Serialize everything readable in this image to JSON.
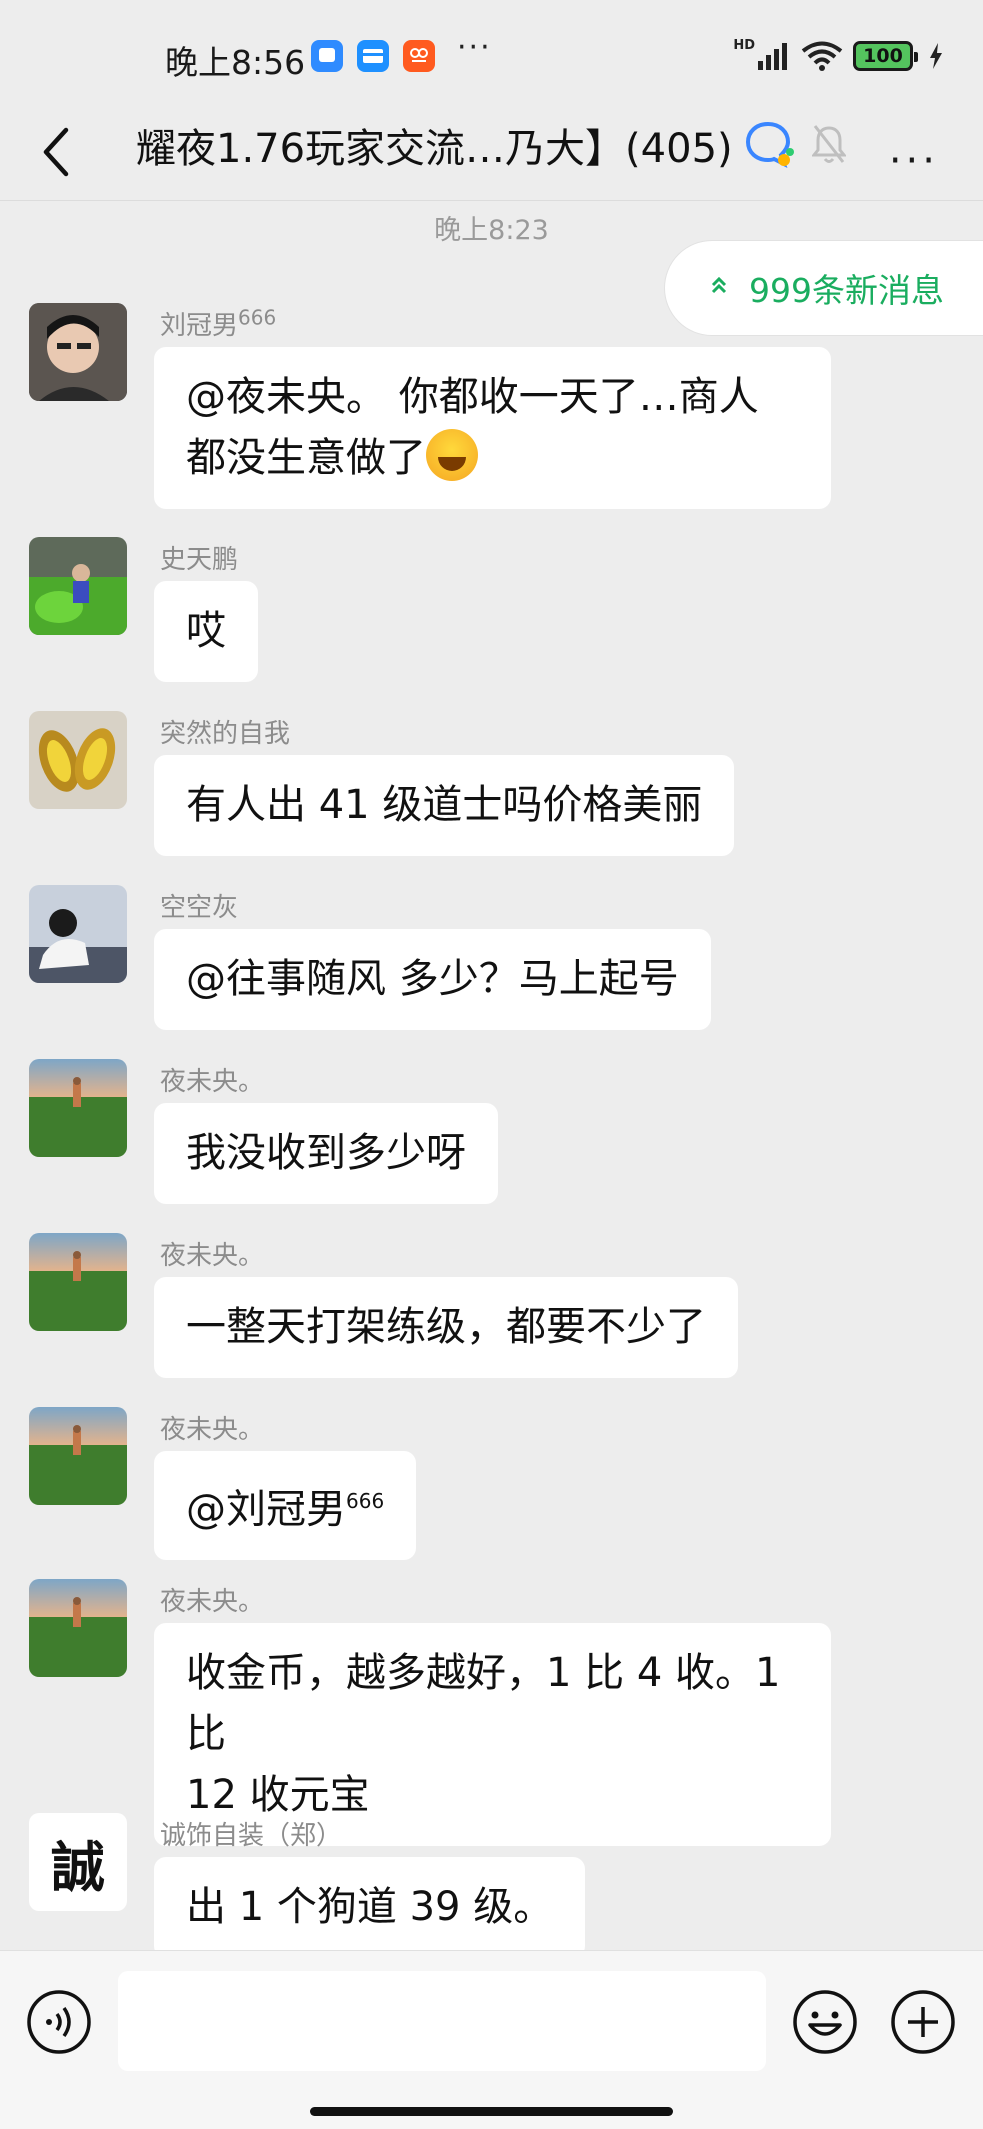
{
  "status_bar": {
    "time": "晚上8:56",
    "dots": "···",
    "network": "HD",
    "battery": "100"
  },
  "header": {
    "title": "耀夜1.76玩家交流…乃大】(405)"
  },
  "timestamp": "晚上8:23",
  "new_messages": {
    "label": "999条新消息",
    "arrow": "⌃"
  },
  "messages": [
    {
      "sender": "刘冠男",
      "sender_sup": "666",
      "lines": [
        "@夜未央。  你都收一天了…商人",
        "都没生意做了"
      ]
    },
    {
      "sender": "史天鹏",
      "lines": [
        "哎"
      ]
    },
    {
      "sender": "突然的自我",
      "lines": [
        "有人出 41 级道士吗价格美丽"
      ]
    },
    {
      "sender": "空空灰",
      "lines": [
        "@往事随风  多少？马上起号"
      ]
    },
    {
      "sender": "夜未央。",
      "lines": [
        "我没收到多少呀"
      ]
    },
    {
      "sender": "夜未央。",
      "lines": [
        "一整天打架练级，都要不少了"
      ]
    },
    {
      "sender": "夜未央。",
      "lines": [
        "@刘冠男"
      ],
      "line_sup": "666"
    },
    {
      "sender": "夜未央。",
      "lines": [
        "收金币，越多越好，1 比 4 收。1 比",
        "12 收元宝"
      ]
    },
    {
      "sender": "诚饰自装（郑）",
      "avatar_text": "誠",
      "lines": [
        "出 1 个狗道 39 级。"
      ]
    }
  ],
  "colors": {
    "background": "#ededed",
    "bubble": "#ffffff",
    "accent_green": "#1aad5f"
  }
}
